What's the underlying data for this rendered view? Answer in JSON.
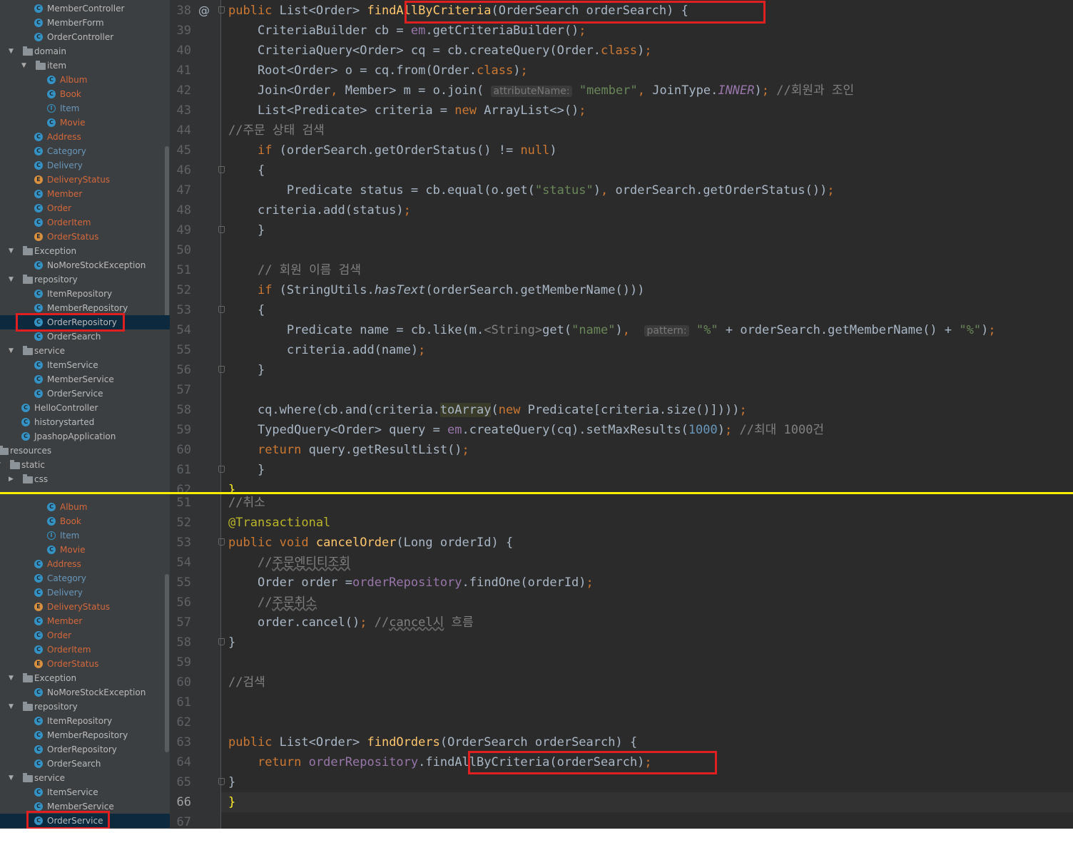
{
  "top": {
    "tree": [
      {
        "label": "MemberController",
        "icon": "c",
        "state": "norm",
        "indent": 48
      },
      {
        "label": "MemberForm",
        "icon": "c",
        "state": "norm",
        "indent": 48
      },
      {
        "label": "OrderController",
        "icon": "c",
        "state": "norm",
        "indent": 48
      },
      {
        "label": "domain",
        "icon": "folder",
        "state": "norm",
        "indent": 30,
        "arrow": "▼"
      },
      {
        "label": "item",
        "icon": "folder",
        "state": "norm",
        "indent": 48,
        "arrow": "▼"
      },
      {
        "label": "Album",
        "icon": "c",
        "state": "mod",
        "indent": 66
      },
      {
        "label": "Book",
        "icon": "c",
        "state": "mod",
        "indent": 66
      },
      {
        "label": "Item",
        "icon": "i",
        "state": "chg",
        "indent": 66
      },
      {
        "label": "Movie",
        "icon": "c",
        "state": "mod",
        "indent": 66
      },
      {
        "label": "Address",
        "icon": "c",
        "state": "mod",
        "indent": 48
      },
      {
        "label": "Category",
        "icon": "c",
        "state": "chg",
        "indent": 48
      },
      {
        "label": "Delivery",
        "icon": "c",
        "state": "chg",
        "indent": 48
      },
      {
        "label": "DeliveryStatus",
        "icon": "e",
        "state": "mod",
        "indent": 48
      },
      {
        "label": "Member",
        "icon": "c",
        "state": "mod",
        "indent": 48
      },
      {
        "label": "Order",
        "icon": "c",
        "state": "mod",
        "indent": 48
      },
      {
        "label": "OrderItem",
        "icon": "c",
        "state": "mod",
        "indent": 48
      },
      {
        "label": "OrderStatus",
        "icon": "e",
        "state": "mod",
        "indent": 48
      },
      {
        "label": "Exception",
        "icon": "folder",
        "state": "norm",
        "indent": 30,
        "arrow": "▼"
      },
      {
        "label": "NoMoreStockException",
        "icon": "a",
        "state": "norm",
        "indent": 48
      },
      {
        "label": "repository",
        "icon": "folder",
        "state": "norm",
        "indent": 30,
        "arrow": "▼"
      },
      {
        "label": "ItemRepository",
        "icon": "c",
        "state": "norm",
        "indent": 48
      },
      {
        "label": "MemberRepository",
        "icon": "c",
        "state": "norm",
        "indent": 48
      },
      {
        "label": "OrderRepository",
        "icon": "c",
        "state": "norm",
        "indent": 48,
        "selected": true
      },
      {
        "label": "OrderSearch",
        "icon": "c",
        "state": "norm",
        "indent": 48
      },
      {
        "label": "service",
        "icon": "folder",
        "state": "norm",
        "indent": 30,
        "arrow": "▼"
      },
      {
        "label": "ItemService",
        "icon": "c",
        "state": "norm",
        "indent": 48
      },
      {
        "label": "MemberService",
        "icon": "c",
        "state": "norm",
        "indent": 48
      },
      {
        "label": "OrderService",
        "icon": "c",
        "state": "norm",
        "indent": 48
      },
      {
        "label": "HelloController",
        "icon": "c",
        "state": "norm",
        "indent": 30
      },
      {
        "label": "historystarted",
        "icon": "c",
        "state": "norm",
        "indent": 30
      },
      {
        "label": "JpashopApplication",
        "icon": "j",
        "state": "norm",
        "indent": 30
      },
      {
        "label": "resources",
        "icon": "folder",
        "state": "norm",
        "indent": -4
      },
      {
        "label": "static",
        "icon": "folder",
        "state": "norm",
        "indent": 12,
        "arrow": "▼"
      },
      {
        "label": "css",
        "icon": "folder",
        "state": "norm",
        "indent": 30,
        "arrow": "▶"
      }
    ],
    "lines": [
      {
        "n": "38",
        "at": "@",
        "fold": true,
        "html": "<span class='kw'>public </span>List&lt;Order&gt; <span class='fn'>findAllByCriteria</span>(OrderSearch orderSearch) {"
      },
      {
        "n": "39",
        "html": "    CriteriaBuilder cb = <span class='fld'>em</span>.getCriteriaBuilder()<span class='kw'>;</span>"
      },
      {
        "n": "40",
        "html": "    CriteriaQuery&lt;Order&gt; cq = cb.createQuery(Order.<span class='kw'>class</span>)<span class='kw'>;</span>"
      },
      {
        "n": "41",
        "html": "    Root&lt;Order&gt; o = cq.from(Order.<span class='kw'>class</span>)<span class='kw'>;</span>"
      },
      {
        "n": "42",
        "html": "    Join&lt;Order<span class='kw'>, </span>Member&gt; m = o.join( <span class='hint'>attributeName:</span> <span class='str'>\"member\"</span><span class='kw'>, </span>JoinType.<span class='fld it'>INNER</span>)<span class='kw'>; </span><span class='cmt'>//회원과 조인</span>"
      },
      {
        "n": "43",
        "html": "    List&lt;Predicate&gt; criteria = <span class='kw'>new </span>ArrayList&lt;&gt;()<span class='kw'>;</span>"
      },
      {
        "n": "44",
        "html": "<span class='cmt'>//주문 상태 검색</span>"
      },
      {
        "n": "45",
        "html": "    <span class='kw'>if </span>(orderSearch.getOrderStatus() != <span class='kw'>null</span>)"
      },
      {
        "n": "46",
        "fold": true,
        "html": "    {"
      },
      {
        "n": "47",
        "html": "        Predicate status = cb.equal(o.get(<span class='str'>\"status\"</span>)<span class='kw'>, </span>orderSearch.getOrderStatus())<span class='kw'>;</span>"
      },
      {
        "n": "48",
        "html": "    criteria.add(status)<span class='kw'>;</span>"
      },
      {
        "n": "49",
        "fold": true,
        "html": "    }"
      },
      {
        "n": "50",
        "html": ""
      },
      {
        "n": "51",
        "html": "    <span class='cmt'>// 회원 이름 검색</span>"
      },
      {
        "n": "52",
        "html": "    <span class='kw'>if </span>(StringUtils.<span class='it'>hasText</span>(orderSearch.getMemberName()))"
      },
      {
        "n": "53",
        "fold": true,
        "html": "    {"
      },
      {
        "n": "54",
        "html": "        Predicate name = cb.like(m.<span class='cmt'>&lt;String&gt;</span>get(<span class='str'>\"name\"</span>)<span class='kw'>, </span> <span class='hint'>pattern:</span> <span class='str'>\"%\"</span> + orderSearch.getMemberName() + <span class='str'>\"%\"</span>)<span class='kw'>;</span>"
      },
      {
        "n": "55",
        "html": "        criteria.add(name)<span class='kw'>;</span>"
      },
      {
        "n": "56",
        "fold": true,
        "html": "    }"
      },
      {
        "n": "57",
        "html": ""
      },
      {
        "n": "58",
        "html": "    cq.where(cb.and(criteria.<span class='hl'>toArray</span>(<span class='kw'>new </span>Predicate[criteria.size()])))<span class='kw'>;</span>"
      },
      {
        "n": "59",
        "html": "    TypedQuery&lt;Order&gt; query = <span class='fld'>em</span>.createQuery(cq).setMaxResults(<span class='num'>1000</span>)<span class='kw'>; </span><span class='cmt'>//최대 1000건</span>"
      },
      {
        "n": "60",
        "html": "    <span class='kw'>return </span>query.getResultList()<span class='kw'>;</span>"
      },
      {
        "n": "61",
        "fold": true,
        "html": "    }"
      },
      {
        "n": "62",
        "html": "<span style='color:#ffef28'>}</span>"
      }
    ]
  },
  "bottom": {
    "tree": [
      {
        "label": "Album",
        "icon": "c",
        "state": "mod",
        "indent": 66
      },
      {
        "label": "Book",
        "icon": "c",
        "state": "mod",
        "indent": 66
      },
      {
        "label": "Item",
        "icon": "i",
        "state": "chg",
        "indent": 66
      },
      {
        "label": "Movie",
        "icon": "c",
        "state": "mod",
        "indent": 66
      },
      {
        "label": "Address",
        "icon": "c",
        "state": "mod",
        "indent": 48
      },
      {
        "label": "Category",
        "icon": "c",
        "state": "chg",
        "indent": 48
      },
      {
        "label": "Delivery",
        "icon": "c",
        "state": "chg",
        "indent": 48
      },
      {
        "label": "DeliveryStatus",
        "icon": "e",
        "state": "mod",
        "indent": 48
      },
      {
        "label": "Member",
        "icon": "c",
        "state": "mod",
        "indent": 48
      },
      {
        "label": "Order",
        "icon": "c",
        "state": "mod",
        "indent": 48
      },
      {
        "label": "OrderItem",
        "icon": "c",
        "state": "mod",
        "indent": 48
      },
      {
        "label": "OrderStatus",
        "icon": "e",
        "state": "mod",
        "indent": 48
      },
      {
        "label": "Exception",
        "icon": "folder",
        "state": "norm",
        "indent": 30,
        "arrow": "▼"
      },
      {
        "label": "NoMoreStockException",
        "icon": "a",
        "state": "norm",
        "indent": 48
      },
      {
        "label": "repository",
        "icon": "folder",
        "state": "norm",
        "indent": 30,
        "arrow": "▼"
      },
      {
        "label": "ItemRepository",
        "icon": "c",
        "state": "norm",
        "indent": 48
      },
      {
        "label": "MemberRepository",
        "icon": "c",
        "state": "norm",
        "indent": 48
      },
      {
        "label": "OrderRepository",
        "icon": "c",
        "state": "norm",
        "indent": 48
      },
      {
        "label": "OrderSearch",
        "icon": "c",
        "state": "norm",
        "indent": 48
      },
      {
        "label": "service",
        "icon": "folder",
        "state": "norm",
        "indent": 30,
        "arrow": "▼"
      },
      {
        "label": "ItemService",
        "icon": "c",
        "state": "norm",
        "indent": 48
      },
      {
        "label": "MemberService",
        "icon": "c",
        "state": "norm",
        "indent": 48
      },
      {
        "label": "OrderService",
        "icon": "c",
        "state": "norm",
        "indent": 48,
        "selected": true
      }
    ],
    "lines": [
      {
        "n": "51",
        "html": "<span class='cmt'>//취소</span>"
      },
      {
        "n": "52",
        "html": "<span class='ann'>@Transactional</span>"
      },
      {
        "n": "53",
        "fold": true,
        "html": "<span class='kw'>public void </span><span class='fn'>cancelOrder</span>(Long orderId) {"
      },
      {
        "n": "54",
        "html": "    <span class='cmt'>//<span class='under'>주문엔티티조회</span></span>"
      },
      {
        "n": "55",
        "html": "    Order order =<span class='fld'>orderRepository</span>.findOne(orderId)<span class='kw'>;</span>"
      },
      {
        "n": "56",
        "html": "    <span class='cmt'>//<span class='under'>주문취소</span></span>"
      },
      {
        "n": "57",
        "html": "    order.cancel()<span class='kw'>; </span><span class='cmt'>//<span class='under'>cancel시</span> 흐름</span>"
      },
      {
        "n": "58",
        "fold": true,
        "html": "}"
      },
      {
        "n": "59",
        "html": ""
      },
      {
        "n": "60",
        "html": "<span class='cmt'>//검색</span>"
      },
      {
        "n": "61",
        "html": ""
      },
      {
        "n": "62",
        "html": ""
      },
      {
        "n": "63",
        "html": "<span class='kw'>public </span>List&lt;Order&gt; <span class='fn'>findOrders</span>(OrderSearch orderSearch) {"
      },
      {
        "n": "64",
        "html": "    <span class='kw'>return </span><span class='fld'>orderRepository</span>.findAllByCriteria(orderSearch)<span class='kw'>;</span>"
      },
      {
        "n": "65",
        "fold": true,
        "html": "}"
      },
      {
        "n": "66",
        "current": true,
        "html": "<span style='color:#ffef28'>}</span>"
      },
      {
        "n": "67",
        "html": ""
      }
    ]
  }
}
